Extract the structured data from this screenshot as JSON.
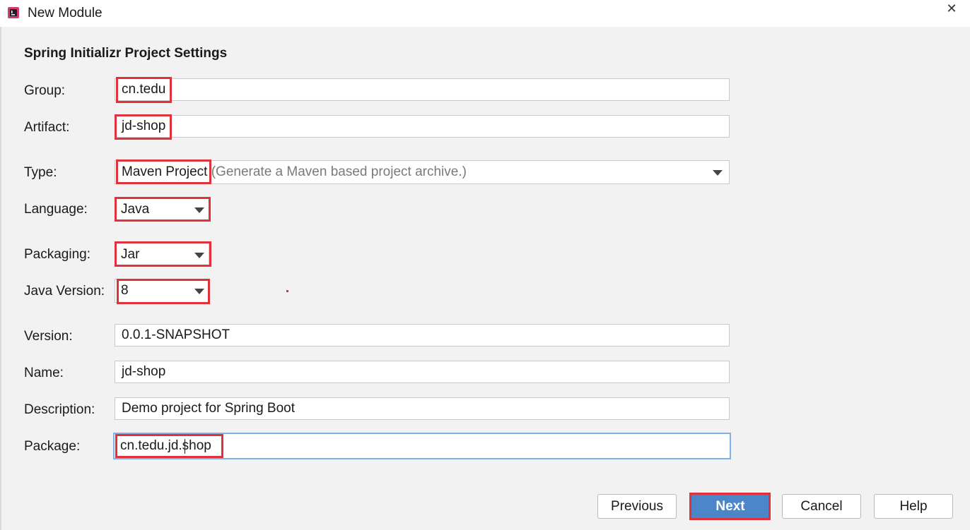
{
  "window": {
    "title": "New Module",
    "close_glyph": "✕"
  },
  "section_title": "Spring Initializr Project Settings",
  "fields": {
    "group": {
      "label": "Group:",
      "value": "cn.tedu"
    },
    "artifact": {
      "label": "Artifact:",
      "value": "jd-shop"
    },
    "type": {
      "label": "Type:",
      "value": "Maven Project",
      "hint": "(Generate a Maven based project archive.)"
    },
    "language": {
      "label": "Language:",
      "value": "Java"
    },
    "packaging": {
      "label": "Packaging:",
      "value": "Jar"
    },
    "java_version": {
      "label": "Java Version:",
      "value": "8"
    },
    "version": {
      "label": "Version:",
      "value": "0.0.1-SNAPSHOT"
    },
    "name": {
      "label": "Name:",
      "value": "jd-shop"
    },
    "description": {
      "label": "Description:",
      "value": "Demo project for Spring Boot"
    },
    "package": {
      "label": "Package:",
      "value": "cn.tedu.jd.shop"
    }
  },
  "buttons": {
    "previous": "Previous",
    "next": "Next",
    "cancel": "Cancel",
    "help": "Help"
  },
  "colors": {
    "highlight": "#e0323a",
    "primary_button": "#4a86c8",
    "focus_border": "#7fb3e8"
  },
  "icons": {
    "app": "intellij-app-icon",
    "close": "close-icon",
    "dropdown": "chevron-down-icon"
  }
}
